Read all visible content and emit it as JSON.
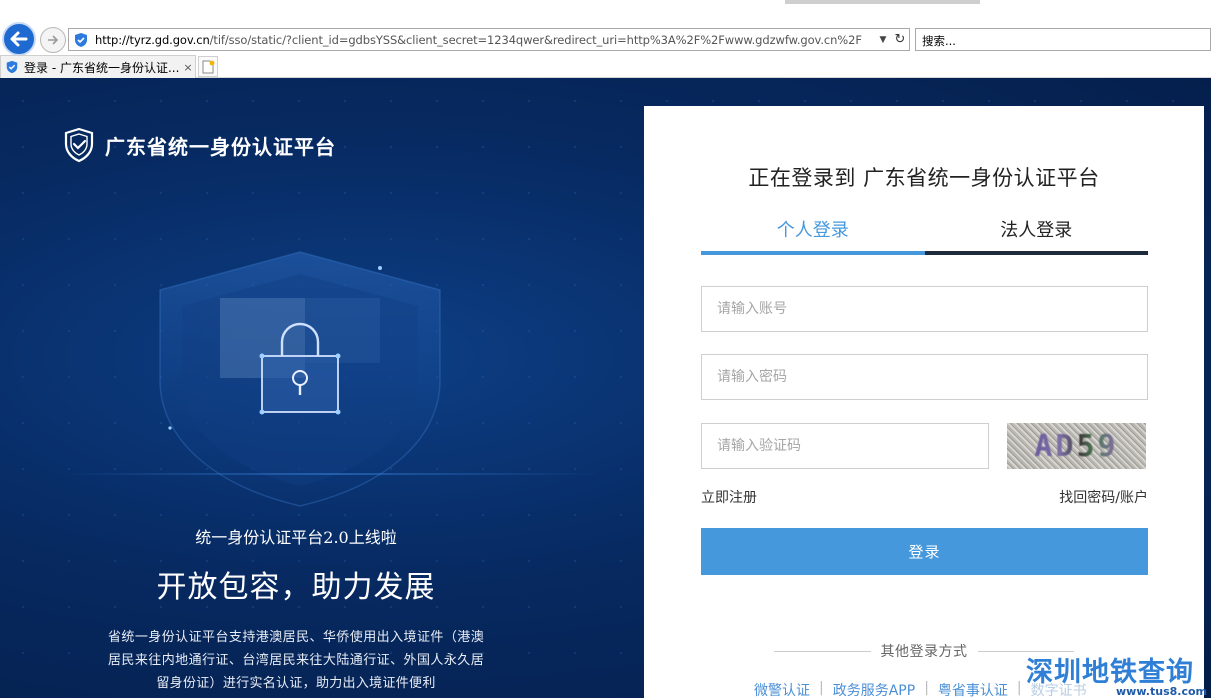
{
  "browser": {
    "url_domain": "http://tyrz.gd.gov.cn",
    "url_rest": "/tif/sso/static/?client_id=gdbsYSS&client_secret=1234qwer&redirect_uri=http%3A%2F%2Fwww.gdzwfw.gov.cn%2F",
    "search_placeholder": "搜索...",
    "tab_title": "登录 - 广东省统一身份认证...",
    "tab_close": "×"
  },
  "brand": {
    "name": "广东省统一身份认证平台"
  },
  "promo": {
    "subtitle": "统一身份认证平台2.0上线啦",
    "headline": "开放包容，助力发展",
    "description": "省统一身份认证平台支持港澳居民、华侨使用出入境证件（港澳居民来往内地通行证、台湾居民来往大陆通行证、外国人永久居留身份证）进行实名认证，助力出入境证件便利"
  },
  "login": {
    "title": "正在登录到 广东省统一身份认证平台",
    "tabs": [
      {
        "label": "个人登录",
        "active": true
      },
      {
        "label": "法人登录",
        "active": false
      }
    ],
    "account_placeholder": "请输入账号",
    "password_placeholder": "请输入密码",
    "captcha_placeholder": "请输入验证码",
    "captcha_text": "AD59",
    "register_link": "立即注册",
    "recover_link": "找回密码/账户",
    "submit_label": "登录",
    "other_methods_label": "其他登录方式",
    "other_methods": [
      "微警认证",
      "政务服务APP",
      "粤省事认证",
      "数字证书"
    ],
    "separator": "|"
  },
  "watermark": {
    "name": "深圳地铁查询",
    "url": "www.tus8.com"
  },
  "colors": {
    "accent": "#4698dd",
    "page_bg": "#072a62",
    "back_button": "#1e6ad0"
  }
}
